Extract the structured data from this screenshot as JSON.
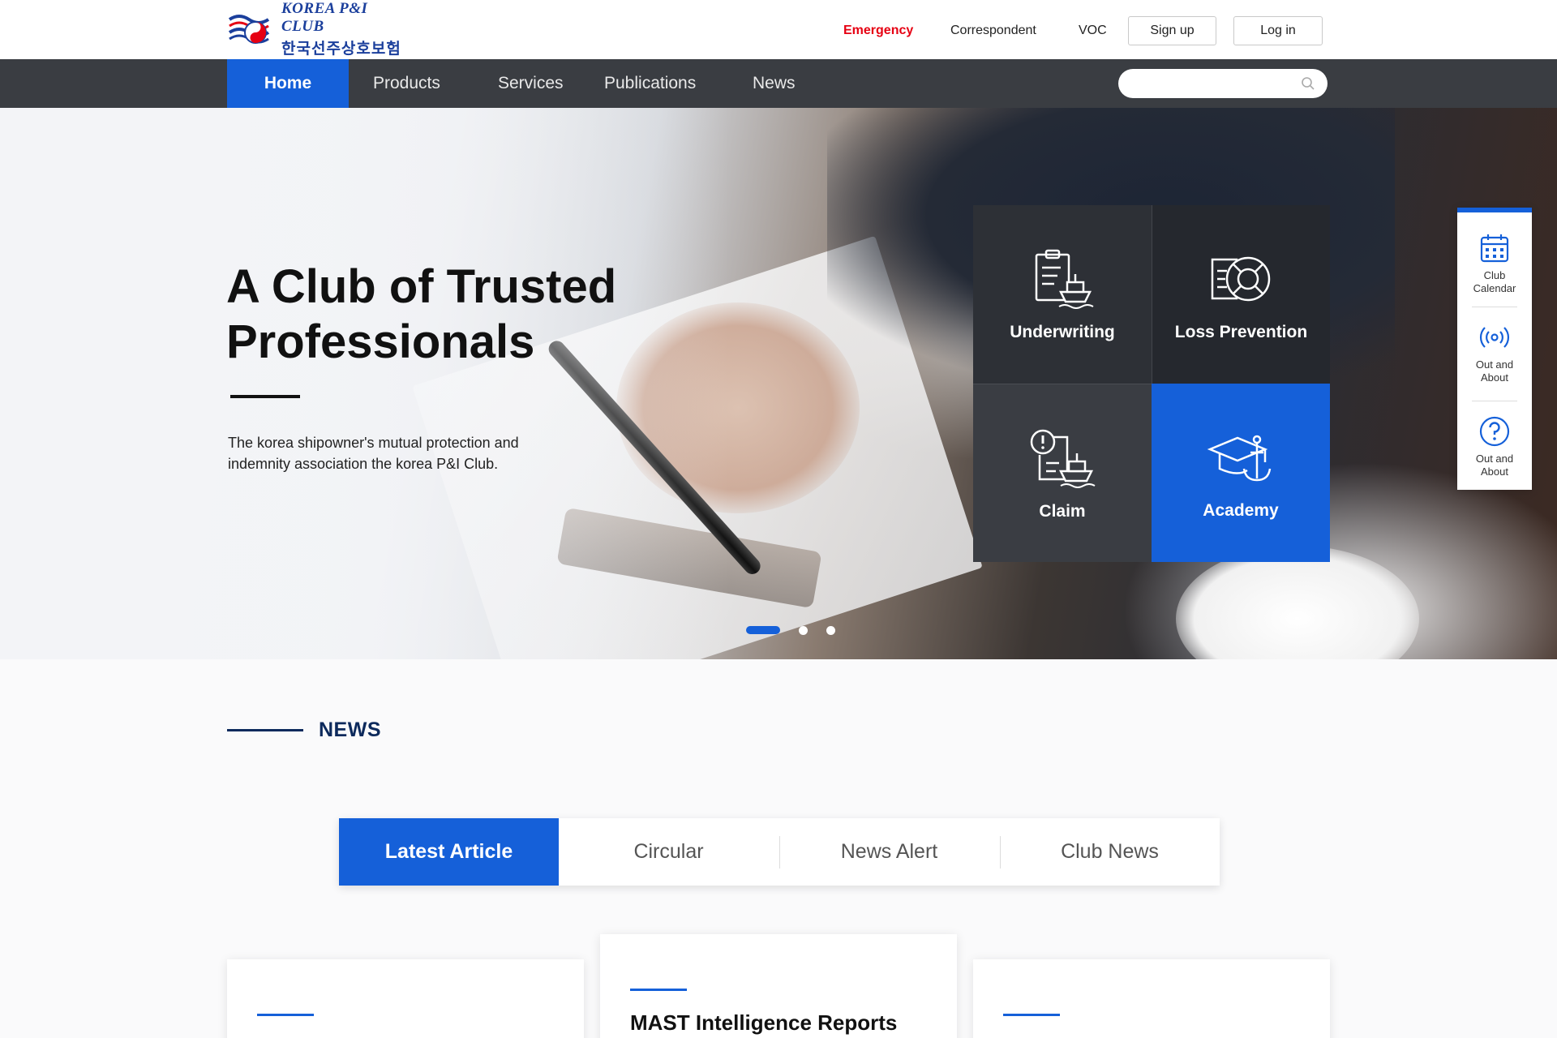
{
  "header": {
    "logo": {
      "en": "KOREA P&I CLUB",
      "ko": "한국선주상호보험"
    },
    "util_links": {
      "emergency": "Emergency",
      "correspondent": "Correspondent",
      "voc": "VOC"
    },
    "buttons": {
      "signup": "Sign up",
      "login": "Log in"
    }
  },
  "nav": {
    "items": [
      "Home",
      "Products",
      "Services",
      "Publications",
      "News"
    ],
    "active": "Home",
    "search": {
      "placeholder": ""
    }
  },
  "hero": {
    "title": "A Club of Trusted Professionals",
    "description": "The korea shipowner's mutual protection and indemnity association the korea P&I Club.",
    "slides": {
      "count": 3,
      "active": 1
    }
  },
  "services": [
    {
      "label": "Underwriting",
      "icon": "clipboard-ship-icon"
    },
    {
      "label": "Loss Prevention",
      "icon": "lifebuoy-icon"
    },
    {
      "label": "Claim",
      "icon": "claim-ship-icon"
    },
    {
      "label": "Academy",
      "icon": "graduation-anchor-icon"
    }
  ],
  "quick_menu": [
    {
      "label": "Club Calendar",
      "icon": "calendar-icon"
    },
    {
      "label": "Out and About",
      "icon": "broadcast-icon"
    },
    {
      "label": "Out and About",
      "icon": "question-icon"
    }
  ],
  "news": {
    "section_title": "NEWS",
    "tabs": [
      "Latest Article",
      "Circular",
      "News Alert",
      "Club News"
    ],
    "active_tab": "Latest Article",
    "cards": [
      {
        "title": ""
      },
      {
        "title": "MAST Intelligence Reports"
      },
      {
        "title": ""
      }
    ]
  },
  "colors": {
    "accent": "#1560d9",
    "nav_bg": "#3a3d42",
    "emergency": "#e60012",
    "news_title": "#0d2a5c"
  }
}
